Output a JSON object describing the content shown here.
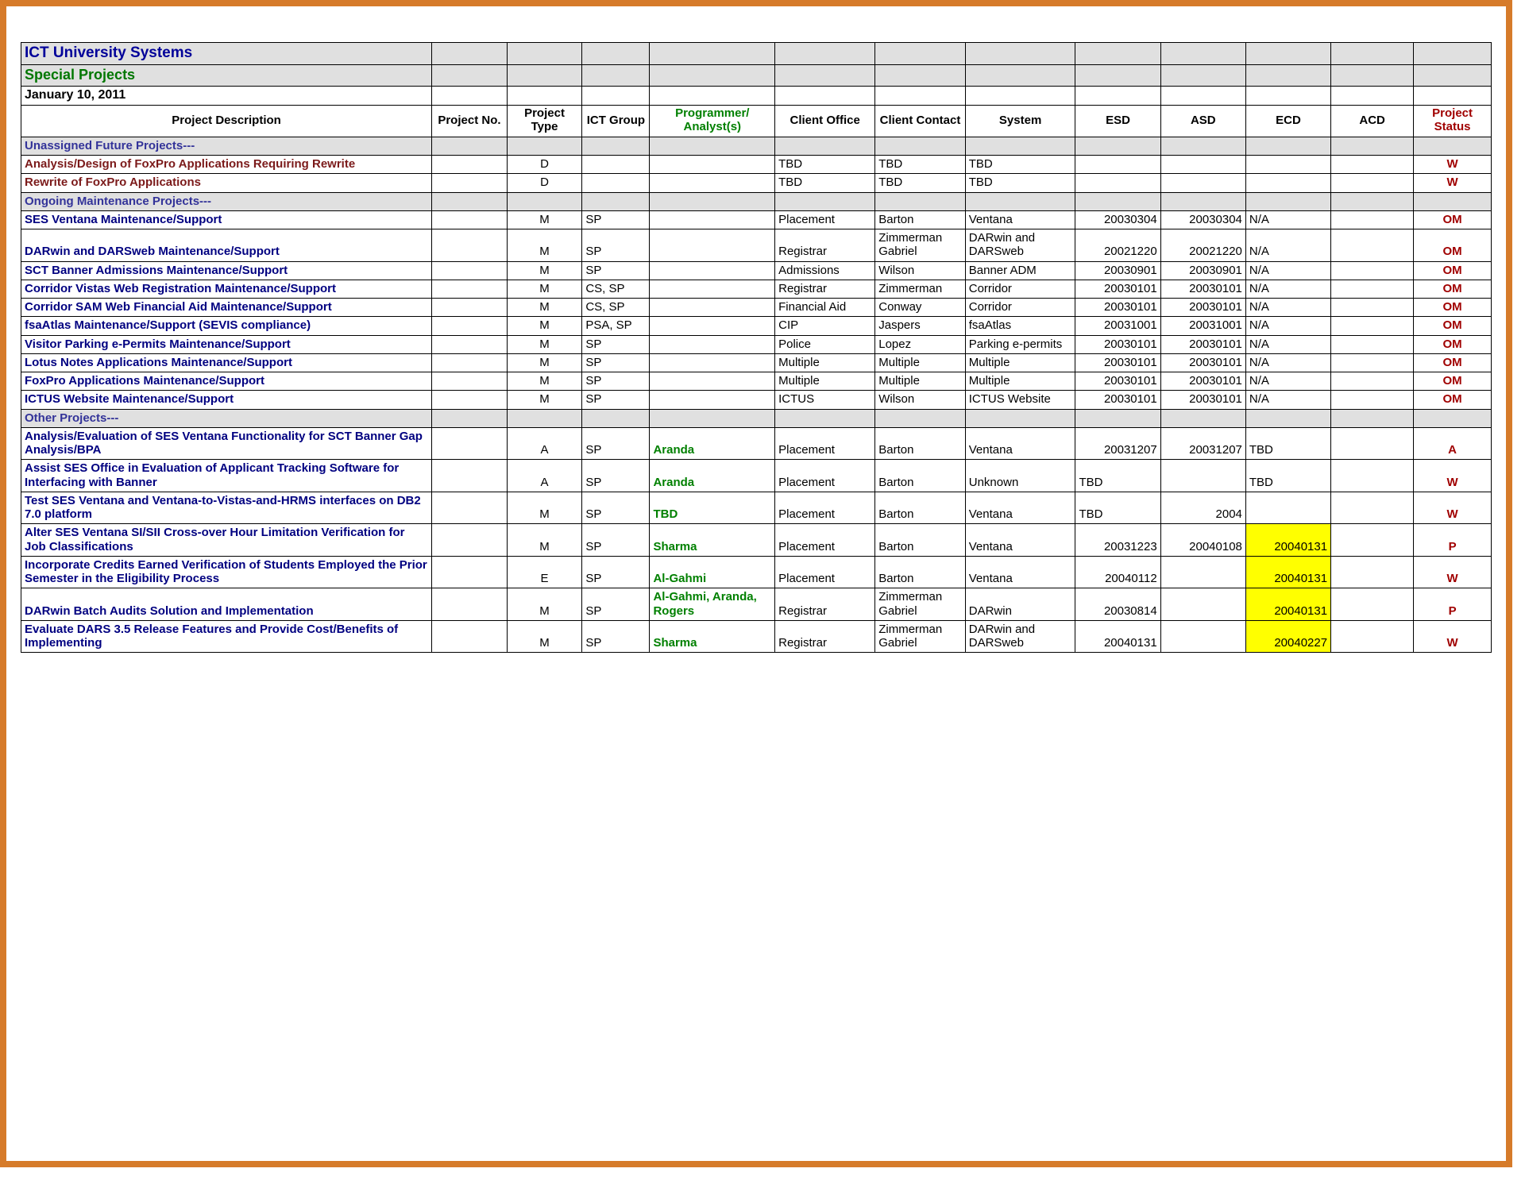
{
  "header": {
    "org": "ICT University Systems",
    "special": "Special Projects",
    "date": "January 10, 2011"
  },
  "columns": {
    "desc": "Project Description",
    "pno": "Project No.",
    "ptype": "Project Type",
    "ict": "ICT Group",
    "prog": "Programmer/ Analyst(s)",
    "office": "Client Office",
    "contact": "Client Contact",
    "system": "System",
    "esd": "ESD",
    "asd": "ASD",
    "ecd": "ECD",
    "acd": "ACD",
    "status": "Project Status"
  },
  "sections": {
    "unassigned": "Unassigned Future Projects---",
    "ongoing": "Ongoing Maintenance Projects---",
    "other": "Other Projects---"
  },
  "rows": {
    "r1": {
      "desc": "Analysis/Design of FoxPro Applications Requiring Rewrite",
      "ptype": "D",
      "office": "TBD",
      "contact": "TBD",
      "system": "TBD",
      "status": "W"
    },
    "r2": {
      "desc": "Rewrite of FoxPro Applications",
      "ptype": "D",
      "office": "TBD",
      "contact": "TBD",
      "system": "TBD",
      "status": "W"
    },
    "r3": {
      "desc": "SES Ventana Maintenance/Support",
      "ptype": "M",
      "ict": "SP",
      "office": "Placement",
      "contact": "Barton",
      "system": "Ventana",
      "esd": "20030304",
      "asd": "20030304",
      "ecd": "N/A",
      "status": "OM"
    },
    "r4": {
      "desc": "DARwin and DARSweb Maintenance/Support",
      "ptype": "M",
      "ict": "SP",
      "office": "Registrar",
      "contact": "Zimmerman Gabriel",
      "system": "DARwin and DARSweb",
      "esd": "20021220",
      "asd": "20021220",
      "ecd": "N/A",
      "status": "OM"
    },
    "r5": {
      "desc": "SCT Banner Admissions Maintenance/Support",
      "ptype": "M",
      "ict": "SP",
      "office": "Admissions",
      "contact": "Wilson",
      "system": "Banner ADM",
      "esd": "20030901",
      "asd": "20030901",
      "ecd": "N/A",
      "status": "OM"
    },
    "r6": {
      "desc": "Corridor Vistas Web Registration Maintenance/Support",
      "ptype": "M",
      "ict": "CS, SP",
      "office": "Registrar",
      "contact": "Zimmerman",
      "system": "Corridor",
      "esd": "20030101",
      "asd": "20030101",
      "ecd": "N/A",
      "status": "OM"
    },
    "r7": {
      "desc": "Corridor SAM Web Financial Aid Maintenance/Support",
      "ptype": "M",
      "ict": "CS, SP",
      "office": "Financial Aid",
      "contact": "Conway",
      "system": "Corridor",
      "esd": "20030101",
      "asd": "20030101",
      "ecd": "N/A",
      "status": "OM"
    },
    "r8": {
      "desc": "fsaAtlas Maintenance/Support (SEVIS compliance)",
      "ptype": "M",
      "ict": "PSA, SP",
      "office": "CIP",
      "contact": "Jaspers",
      "system": "fsaAtlas",
      "esd": "20031001",
      "asd": "20031001",
      "ecd": "N/A",
      "status": "OM"
    },
    "r9": {
      "desc": "Visitor Parking e-Permits Maintenance/Support",
      "ptype": "M",
      "ict": "SP",
      "office": "Police",
      "contact": "Lopez",
      "system": "Parking e-permits",
      "esd": "20030101",
      "asd": "20030101",
      "ecd": "N/A",
      "status": "OM"
    },
    "r10": {
      "desc": "Lotus Notes Applications Maintenance/Support",
      "ptype": "M",
      "ict": "SP",
      "office": "Multiple",
      "contact": "Multiple",
      "system": "Multiple",
      "esd": "20030101",
      "asd": "20030101",
      "ecd": "N/A",
      "status": "OM"
    },
    "r11": {
      "desc": "FoxPro Applications Maintenance/Support",
      "ptype": "M",
      "ict": "SP",
      "office": "Multiple",
      "contact": "Multiple",
      "system": "Multiple",
      "esd": "20030101",
      "asd": "20030101",
      "ecd": "N/A",
      "status": "OM"
    },
    "r12": {
      "desc": "ICTUS Website Maintenance/Support",
      "ptype": "M",
      "ict": "SP",
      "office": "ICTUS",
      "contact": "Wilson",
      "system": "ICTUS Website",
      "esd": "20030101",
      "asd": "20030101",
      "ecd": "N/A",
      "status": "OM"
    },
    "r13": {
      "desc": "Analysis/Evaluation of SES Ventana Functionality for SCT Banner Gap Analysis/BPA",
      "ptype": "A",
      "ict": "SP",
      "prog": "Aranda",
      "office": "Placement",
      "contact": "Barton",
      "system": "Ventana",
      "esd": "20031207",
      "asd": "20031207",
      "ecd": "TBD",
      "status": "A"
    },
    "r14": {
      "desc": "Assist SES Office in Evaluation of Applicant Tracking Software for Interfacing with Banner",
      "ptype": "A",
      "ict": "SP",
      "prog": "Aranda",
      "office": "Placement",
      "contact": "Barton",
      "system": "Unknown",
      "esd": "TBD",
      "ecd": "TBD",
      "status": "W"
    },
    "r15": {
      "desc": "Test SES Ventana and Ventana-to-Vistas-and-HRMS interfaces on DB2 7.0 platform",
      "ptype": "M",
      "ict": "SP",
      "prog": "TBD",
      "office": "Placement",
      "contact": "Barton",
      "system": "Ventana",
      "esd": "TBD",
      "asd": "2004",
      "status": "W"
    },
    "r16": {
      "desc": "Alter SES Ventana SI/SII Cross-over Hour Limitation Verification for Job Classifications",
      "ptype": "M",
      "ict": "SP",
      "prog": "Sharma",
      "office": "Placement",
      "contact": "Barton",
      "system": "Ventana",
      "esd": "20031223",
      "asd": "20040108",
      "ecd": "20040131",
      "status": "P"
    },
    "r17": {
      "desc": "Incorporate Credits Earned Verification of Students Employed the Prior Semester in the Eligibility Process",
      "ptype": "E",
      "ict": "SP",
      "prog": "Al-Gahmi",
      "office": "Placement",
      "contact": "Barton",
      "system": "Ventana",
      "esd": "20040112",
      "ecd": "20040131",
      "status": "W"
    },
    "r18": {
      "desc": "DARwin Batch Audits Solution and Implementation",
      "ptype": "M",
      "ict": "SP",
      "prog": "Al-Gahmi, Aranda, Rogers",
      "office": "Registrar",
      "contact": "Zimmerman Gabriel",
      "system": "DARwin",
      "esd": "20030814",
      "ecd": "20040131",
      "status": "P"
    },
    "r19": {
      "desc": "Evaluate DARS 3.5 Release Features and Provide Cost/Benefits of Implementing",
      "ptype": "M",
      "ict": "SP",
      "prog": "Sharma",
      "office": "Registrar",
      "contact": "Zimmerman Gabriel",
      "system": "DARwin and DARSweb",
      "esd": "20040131",
      "ecd": "20040227",
      "status": "W"
    }
  }
}
